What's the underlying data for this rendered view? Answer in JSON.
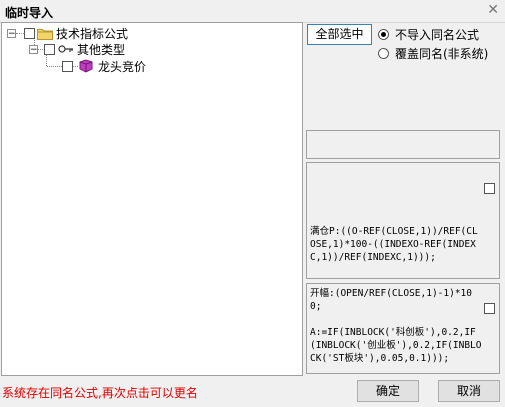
{
  "window": {
    "title": "临时导入",
    "close_glyph": "✕"
  },
  "tree": {
    "root": {
      "label": "技术指标公式",
      "expander": "−",
      "icon": "folder-icon"
    },
    "group": {
      "label": "其他类型",
      "expander": "−",
      "icon": "key-icon"
    },
    "leaf": {
      "label": "龙头竞价",
      "icon": "formula-icon"
    }
  },
  "options": {
    "select_all_label": "全部选中",
    "radio_skip_label": "不导入同名公式",
    "radio_overwrite_label": "覆盖同名(非系统)",
    "selected": "skip"
  },
  "preview": {
    "code1": "满仓P:((O-REF(CLOSE,1))/REF(CLOSE,1)*100-((INDEXO-REF(INDEXC,1))/REF(INDEXC,1)));",
    "code2": "开幅:(OPEN/REF(CLOSE,1)-1)*100;\n\nA:=IF(INBLOCK('科创板'),0.2,IF(INBLOCK('创业板'),0.2,IF(INBLOCK('ST板块'),0.05,0.1)));"
  },
  "status": {
    "message": "系统存在同名公式,再次点击可以更名",
    "color": "#e00000"
  },
  "buttons": {
    "ok_label": "确定",
    "cancel_label": "取消"
  }
}
